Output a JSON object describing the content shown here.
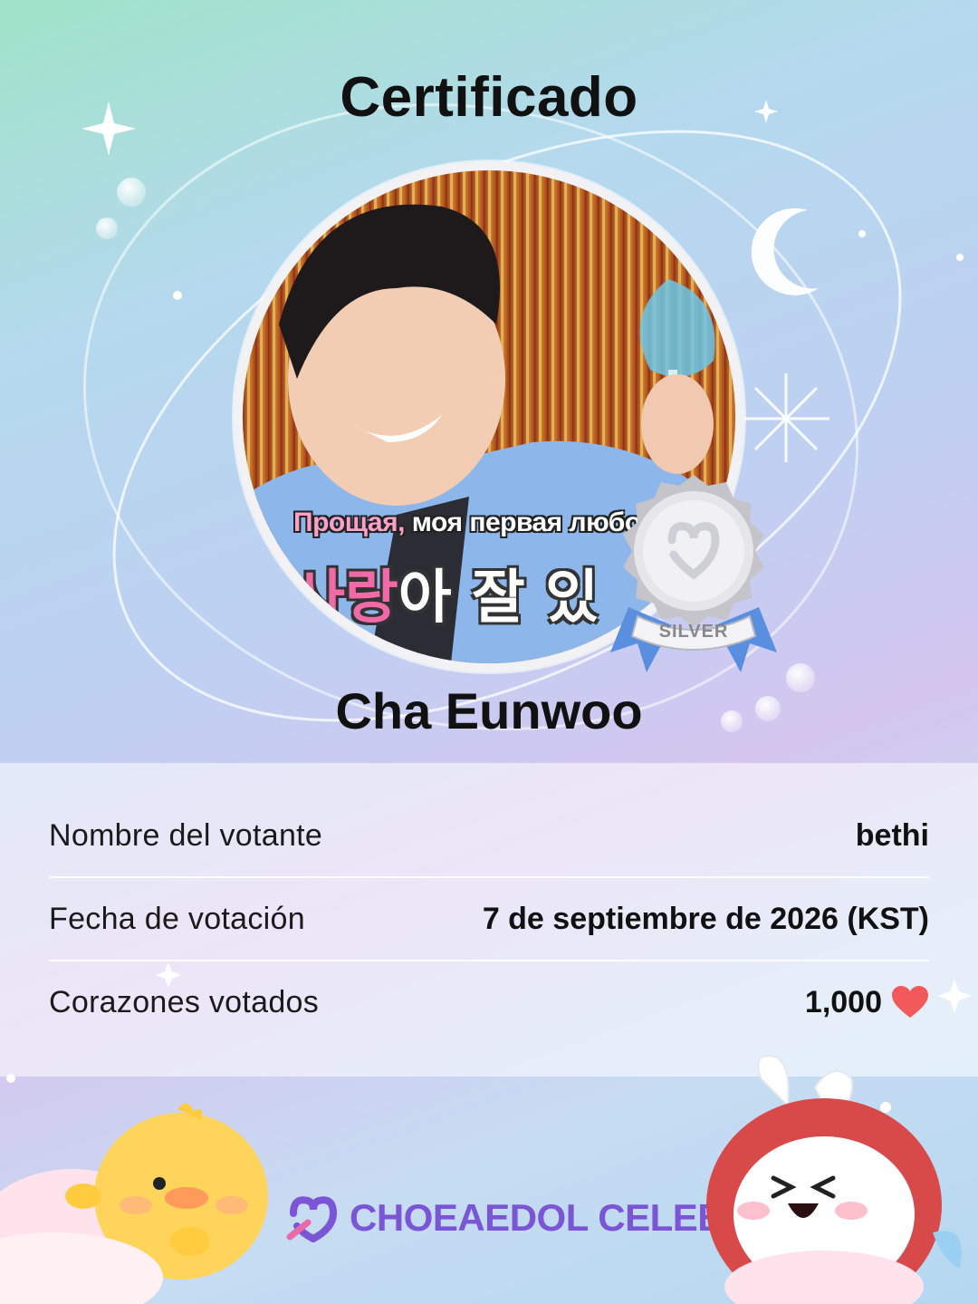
{
  "certificate": {
    "title": "Certificado",
    "celeb_name": "Cha Eunwoo",
    "badge_label": "SILVER",
    "photo_subtitle_ru_pink": "Прощая,",
    "photo_subtitle_ru_white": " моя первая любов",
    "photo_subtitle_ko_pink": "사랑",
    "photo_subtitle_ko_white": "아 잘 있",
    "fields": [
      {
        "label": "Nombre del votante",
        "value": "bethi"
      },
      {
        "label": "Fecha de votación",
        "value": "7 de septiembre de 2026 (KST)"
      },
      {
        "label": "Corazones votados",
        "value": "1,000"
      }
    ]
  },
  "brand": {
    "name": "CHOEAEDOL CELEB"
  },
  "icons": {
    "heart": "heart-icon",
    "logo": "choeaedol-logo-icon"
  },
  "colors": {
    "heart": "#f25a5a",
    "brand": "#7a55d6",
    "badge_ribbon": "#5a8fe0",
    "badge_medal": "#cfcfd4"
  }
}
